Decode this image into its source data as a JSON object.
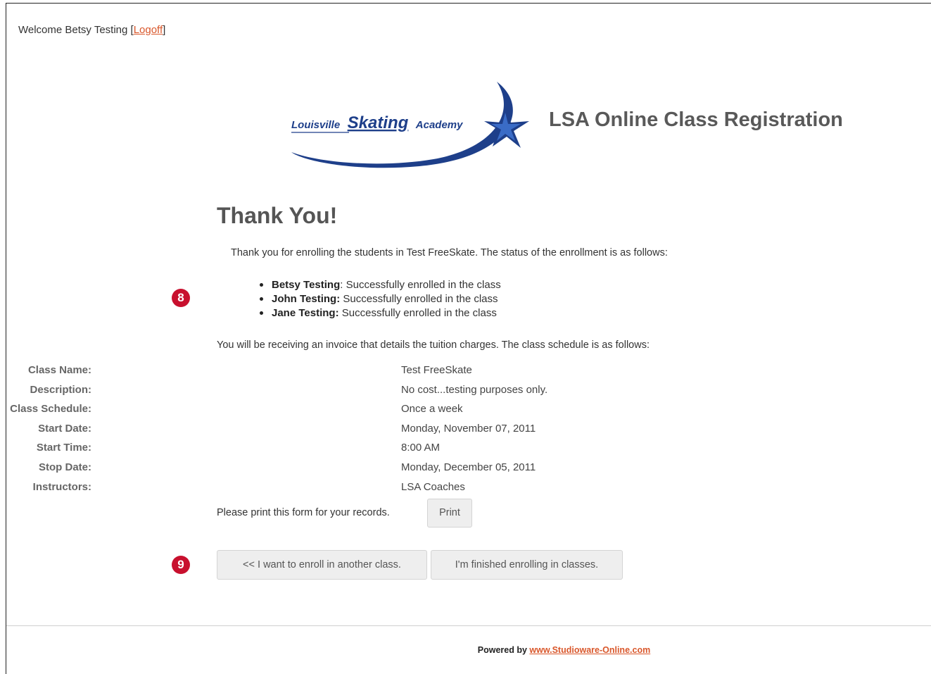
{
  "header": {
    "welcome_text": "Welcome Betsy Testing [",
    "logoff_label": "Logoff",
    "welcome_close": "]"
  },
  "brand": {
    "logo_text_1": "Louisville",
    "logo_text_2": "Skating",
    "logo_text_3": "Academy",
    "app_title": "LSA Online Class Registration",
    "accent_color": "#1e3f8a",
    "link_color": "#d9572b"
  },
  "main": {
    "heading": "Thank You!",
    "intro": "Thank you for enrolling the students in Test FreeSkate. The status of the enrollment is as follows:",
    "enrollments": [
      {
        "name": "Betsy Testing",
        "sep": ": ",
        "status": "Successfully enrolled in the class"
      },
      {
        "name": "John Testing:",
        "sep": " ",
        "status": "Successfully enrolled in the class"
      },
      {
        "name": "Jane Testing:",
        "sep": " ",
        "status": "Successfully enrolled in the class"
      }
    ],
    "invoice_text": "You will be receiving an invoice that details the tuition charges. The class schedule is as follows:",
    "schedule": [
      {
        "label": "Class Name:",
        "value": "Test FreeSkate"
      },
      {
        "label": "Description:",
        "value": "No cost...testing purposes only."
      },
      {
        "label": "Class Schedule:",
        "value": "Once a week"
      },
      {
        "label": "Start Date:",
        "value": "Monday, November 07, 2011"
      },
      {
        "label": "Start Time:",
        "value": "8:00 AM"
      },
      {
        "label": "Stop Date:",
        "value": "Monday, December 05, 2011"
      },
      {
        "label": "Instructors:",
        "value": "LSA Coaches"
      }
    ],
    "print_text": "Please print this form for your records.",
    "print_label": "Print",
    "another_label": "<< I want to enroll in another class.",
    "finished_label": "I'm finished enrolling in classes."
  },
  "callouts": {
    "badge_8": "8",
    "badge_9": "9"
  },
  "footer": {
    "powered_by": "Powered by ",
    "link_text": "www.Studioware-Online.com"
  }
}
